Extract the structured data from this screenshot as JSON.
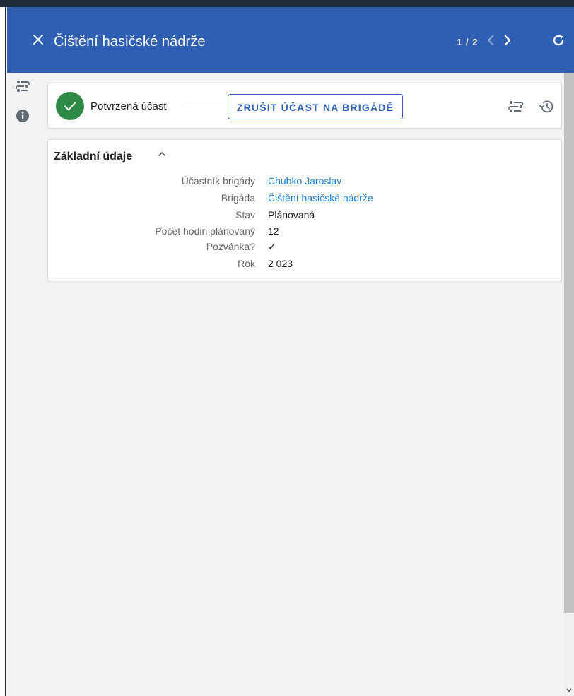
{
  "header": {
    "title": "Čištění hasičské nádrže",
    "pager": "1 / 2"
  },
  "status": {
    "label": "Potvrzená účast",
    "cancel_button": "ZRUŠIT ÚČAST NA BRIGÁDĚ"
  },
  "details": {
    "section_title": "Základní údaje",
    "fields": [
      {
        "label": "Účastník brigády",
        "value": "Chubko Jaroslav"
      },
      {
        "label": "Brigáda",
        "value": "Čištění hasičské nádrže"
      },
      {
        "label": "Stav",
        "value": "Plánovaná"
      },
      {
        "label": "Počet hodin plánovaný",
        "value": "12"
      },
      {
        "label": "Pozvánka?",
        "value": "✓"
      },
      {
        "label": "Rok",
        "value": "2 023"
      }
    ]
  },
  "colors": {
    "header_bg": "#2f5fb3",
    "accent": "#2f5fb3",
    "success": "#2e8b47",
    "link": "#1e7fd1"
  },
  "icons": {
    "close": "close-icon",
    "prev": "chevron-left-icon",
    "next": "chevron-right-icon",
    "refresh": "refresh-icon",
    "workflow": "workflow-icon",
    "info": "info-icon",
    "history": "history-icon",
    "check": "check-icon",
    "collapse": "chevron-up-icon"
  }
}
